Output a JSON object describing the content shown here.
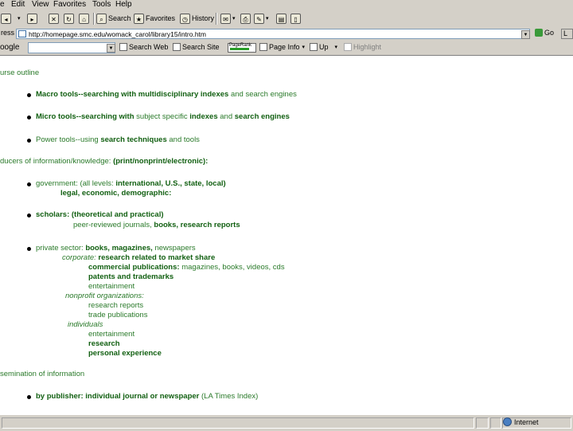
{
  "menubar": {
    "items": [
      "e",
      "Edit",
      "View",
      "Favorites",
      "Tools",
      "Help"
    ]
  },
  "toolbar": {
    "search": "Search",
    "favorites": "Favorites",
    "history": "History"
  },
  "address": {
    "label": "ress",
    "url": "http://homepage.smc.edu/womack_carol/library15/intro.htm",
    "go": "Go",
    "links": "L"
  },
  "google": {
    "label": "oogle",
    "search_web": "Search Web",
    "search_site": "Search Site",
    "pagerank": "PageRank",
    "page_info": "Page Info",
    "up": "Up",
    "highlight": "Highlight"
  },
  "content": {
    "heading1": "urse outline",
    "macro_bold": "Macro tools--searching with multidisciplinary indexes",
    "macro_rest": "and search engines",
    "micro_a": "Micro tools--searching with",
    "micro_b": "subject specific",
    "micro_c": "indexes",
    "micro_d": "and",
    "micro_e": "search engines",
    "power_a": "Power tools--using",
    "power_b": "search techniques",
    "power_c": "and tools",
    "heading2": "ducers of information/knowledge:",
    "heading2_b": "(print/nonprint/electronic):",
    "gov_a": "government:",
    "gov_b": "(all levels:",
    "gov_c": "international, U.S., state, local)",
    "gov_line2": "legal, economic, demographic:",
    "sch_a": "scholars:",
    "sch_b": "(theoretical and practical)",
    "sch_line2_a": "peer-reviewed journals,",
    "sch_line2_b": "books, research reports",
    "priv_a": "private sector:",
    "priv_b": "books, magazines,",
    "priv_c": "newspapers",
    "corp_a": "corporate:",
    "corp_b": "research related to market share",
    "comm_a": "commercial publications:",
    "comm_b": "magazines, books, videos, cds",
    "patents": "patents and trademarks",
    "entertainment1": "entertainment",
    "nonprofit": "nonprofit organizations:",
    "research_reports": "research reports",
    "trade_pubs": "trade publications",
    "individuals": "individuals",
    "entertainment2": "entertainment",
    "research": "research",
    "personal": "personal experience",
    "heading3": "semination of information",
    "pub_a": "by publisher:",
    "pub_b": "individual journal or newspaper",
    "pub_c": "(LA Times Index)"
  },
  "status": {
    "zone": "Internet"
  },
  "colors": {
    "text_green": "#2a7a2a",
    "text_dark_green": "#126012",
    "chrome": "#d4d0c8"
  }
}
